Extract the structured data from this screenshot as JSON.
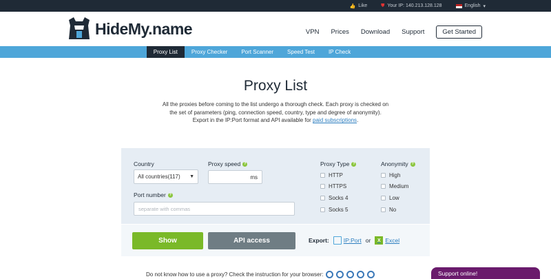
{
  "topbar": {
    "like": "Like",
    "ip": "Your IP: 140.213.128.128",
    "language": "English"
  },
  "logo": {
    "text": "HideMy.name"
  },
  "nav": {
    "items": [
      "VPN",
      "Prices",
      "Download",
      "Support"
    ],
    "cta": "Get Started"
  },
  "subnav": {
    "tabs": [
      "Proxy List",
      "Proxy Checker",
      "Port Scanner",
      "Speed Test",
      "IP Check"
    ]
  },
  "page": {
    "title": "Proxy List",
    "desc_line1": "All the proxies before coming to the list undergo a thorough check. Each proxy is checked on",
    "desc_line2": "the set of parameters (ping, connection speed, country, type and degree of anonymity).",
    "desc_line3": "Export in the IP:Port format and API available for",
    "desc_link": "paid subscriptions",
    "desc_end": "."
  },
  "filter": {
    "country_label": "Country",
    "country_value": "All countries(117)",
    "speed_label": "Proxy speed",
    "speed_unit": "ms",
    "port_label": "Port number",
    "port_placeholder": "separate with commas",
    "type_label": "Proxy Type",
    "types": [
      "HTTP",
      "HTTPS",
      "Socks 4",
      "Socks 5"
    ],
    "anon_label": "Anonymity",
    "anon_levels": [
      "High",
      "Medium",
      "Low",
      "No"
    ],
    "help": "?"
  },
  "actions": {
    "show": "Show",
    "api": "API access",
    "export_label": "Export:",
    "ipport": "IP:Port",
    "or": "or",
    "excel": "Excel",
    "excel_badge": "X"
  },
  "footer": {
    "text": "Do not know how to use a proxy? Check the instruction for your browser:"
  },
  "chat": {
    "text": "Support online!"
  },
  "colors": {
    "dark": "#1f2a36",
    "blue": "#4ea6d9",
    "green": "#7ab928",
    "gray": "#6f7d84",
    "purple": "#6a1b6c"
  }
}
